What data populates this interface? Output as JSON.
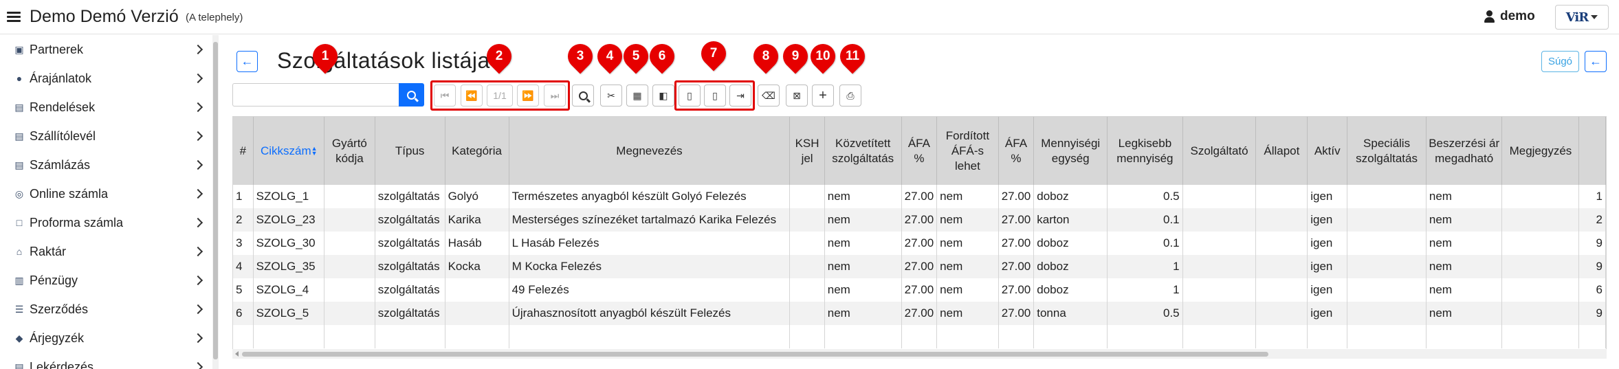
{
  "app": {
    "title": "Demo Demó Verzió",
    "subtitle": "(A telephely)",
    "user": "demo",
    "logo_text": "ViR"
  },
  "sidebar": {
    "items": [
      {
        "label": "Partnerek",
        "icon": "contact-card-icon"
      },
      {
        "label": "Árajánlatok",
        "icon": "chat-bubbles-icon"
      },
      {
        "label": "Rendelések",
        "icon": "document-icon"
      },
      {
        "label": "Szállítólevél",
        "icon": "document-icon"
      },
      {
        "label": "Számlázás",
        "icon": "document-icon"
      },
      {
        "label": "Online számla",
        "icon": "globe-icon"
      },
      {
        "label": "Proforma számla",
        "icon": "note-icon"
      },
      {
        "label": "Raktár",
        "icon": "warehouse-icon"
      },
      {
        "label": "Pénzügy",
        "icon": "money-icon"
      },
      {
        "label": "Szerződés",
        "icon": "contract-icon"
      },
      {
        "label": "Árjegyzék",
        "icon": "tags-icon"
      },
      {
        "label": "Lekérdezés",
        "icon": "document-icon"
      }
    ]
  },
  "page": {
    "title": "Szolgáltatások listája",
    "help_label": "Súgó"
  },
  "search": {
    "value": "",
    "placeholder": ""
  },
  "pager": {
    "label": "1/1"
  },
  "markers": [
    "1",
    "2",
    "3",
    "4",
    "5",
    "6",
    "7",
    "8",
    "9",
    "10",
    "11"
  ],
  "toolbar_icons": {
    "first": "first-page-icon",
    "prev": "previous-page-icon",
    "next": "next-page-icon",
    "last": "last-page-icon",
    "search": "search-icon",
    "tools": "tools-icon",
    "calculator": "calculator-icon",
    "layers": "layers-icon",
    "pdf": "pdf-file-icon",
    "excel": "excel-file-icon",
    "export": "file-export-icon",
    "clear": "backspace-icon",
    "close": "close-square-icon",
    "add": "plus-icon",
    "print": "print-icon"
  },
  "table": {
    "columns": [
      "#",
      "Cikkszám",
      "Gyártó kódja",
      "Típus",
      "Kategória",
      "Megnevezés",
      "KSH jel",
      "Közvetített szolgáltatás",
      "ÁFA %",
      "Fordított ÁFÁ-s lehet",
      "ÁFA %",
      "Mennyiségi egység",
      "Legkisebb mennyiség",
      "Szolgáltató",
      "Állapot",
      "Aktív",
      "Speciális szolgáltatás",
      "Beszerzési ár megadható",
      "Megjegyzés",
      ""
    ],
    "rows": [
      [
        "1",
        "SZOLG_1",
        "",
        "szolgáltatás",
        "Golyó",
        "Természetes anyagból készült Golyó Felezés",
        "",
        "nem",
        "27.00",
        "nem",
        "27.00",
        "doboz",
        "0.5",
        "",
        "",
        "igen",
        "",
        "nem",
        "",
        "1"
      ],
      [
        "2",
        "SZOLG_23",
        "",
        "szolgáltatás",
        "Karika",
        "Mesterséges színezéket tartalmazó Karika Felezés",
        "",
        "nem",
        "27.00",
        "nem",
        "27.00",
        "karton",
        "0.1",
        "",
        "",
        "igen",
        "",
        "nem",
        "",
        "2"
      ],
      [
        "3",
        "SZOLG_30",
        "",
        "szolgáltatás",
        "Hasáb",
        "L Hasáb Felezés",
        "",
        "nem",
        "27.00",
        "nem",
        "27.00",
        "doboz",
        "0.1",
        "",
        "",
        "igen",
        "",
        "nem",
        "",
        "9"
      ],
      [
        "4",
        "SZOLG_35",
        "",
        "szolgáltatás",
        "Kocka",
        "M Kocka Felezés",
        "",
        "nem",
        "27.00",
        "nem",
        "27.00",
        "doboz",
        "1",
        "",
        "",
        "igen",
        "",
        "nem",
        "",
        "9"
      ],
      [
        "5",
        "SZOLG_4",
        "",
        "szolgáltatás",
        "",
        "49 Felezés",
        "",
        "nem",
        "27.00",
        "nem",
        "27.00",
        "doboz",
        "1",
        "",
        "",
        "igen",
        "",
        "nem",
        "",
        "6"
      ],
      [
        "6",
        "SZOLG_5",
        "",
        "szolgáltatás",
        "",
        "Újrahasznosított anyagból készült Felezés",
        "",
        "nem",
        "27.00",
        "nem",
        "27.00",
        "tonna",
        "0.5",
        "",
        "",
        "igen",
        "",
        "nem",
        "",
        "9"
      ]
    ]
  },
  "colors": {
    "accent": "#0d6efd",
    "marker": "#e60000",
    "header_bg": "#d7d7d7"
  }
}
